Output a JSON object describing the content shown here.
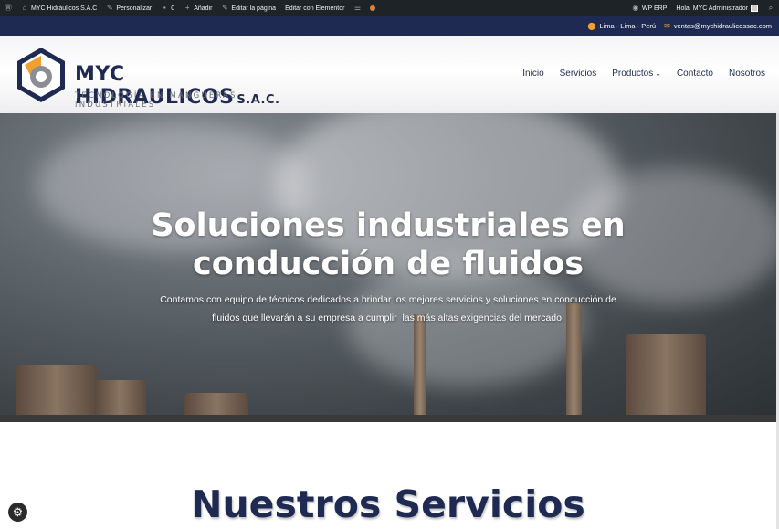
{
  "admin_bar": {
    "site_name": "MYC Hidráulicos S.A.C",
    "customize": "Personalizar",
    "comments_count": "0",
    "add_new": "Añadir",
    "edit_page": "Editar la página",
    "edit_elementor": "Editar con Elementor",
    "wp_erp": "WP ERP",
    "greeting": "Hola, MYC Administrador"
  },
  "topbar": {
    "location": "Lima - Lima - Perú",
    "email": "ventas@mychidraulicossac.com"
  },
  "logo": {
    "title": "MYC HIDRAULICOS",
    "suffix": "S.A.C.",
    "tagline": "TECNOLOGÍA EN MANGUERAS INDUSTRIALES"
  },
  "nav": {
    "items": [
      "Inicio",
      "Servicios",
      "Productos",
      "Contacto",
      "Nosotros"
    ]
  },
  "hero": {
    "title_line1": "Soluciones industriales en",
    "title_line2": "conducción de fluidos",
    "text_line1": "Contamos con equipo de técnicos dedicados a brindar los mejores servicios y soluciones en conducción de",
    "text_line2": "fluidos que llevarán a su empresa a cumplir  las más altas exigencias del mercado."
  },
  "services": {
    "title": "Nuestros Servicios"
  },
  "colors": {
    "navy": "#1f2a52",
    "admin_bar": "#1d2327",
    "accent_orange": "#f0a030",
    "logo_gray": "#6b6f7a"
  },
  "icons": [
    "wordpress-icon",
    "home-icon",
    "pencil-icon",
    "comment-icon",
    "plus-icon",
    "elementor-icon",
    "status-dot-icon",
    "erp-icon",
    "avatar",
    "search-icon",
    "location-pin-icon",
    "email-icon",
    "chevron-down-icon",
    "accessibility-icon"
  ]
}
